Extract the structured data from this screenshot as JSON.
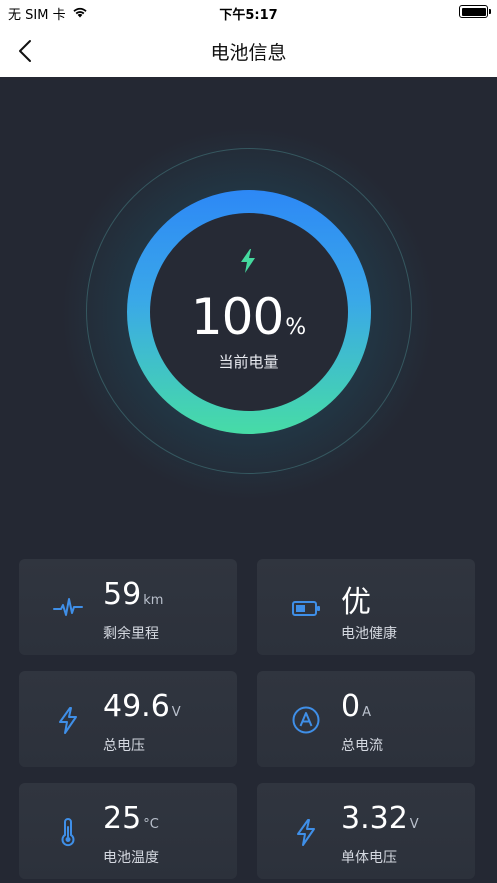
{
  "status_bar": {
    "carrier": "无 SIM 卡",
    "time": "下午5:17"
  },
  "nav": {
    "title": "电池信息"
  },
  "gauge": {
    "percent": "100",
    "unit": "%",
    "label": "当前电量",
    "level": 1.0
  },
  "cards": [
    {
      "value": "59",
      "unit": "km",
      "label": "剩余里程",
      "icon": "pulse-icon"
    },
    {
      "value": "优",
      "unit": "",
      "label": "电池健康",
      "icon": "battery-icon"
    },
    {
      "value": "49.6",
      "unit": "V",
      "label": "总电压",
      "icon": "bolt-icon"
    },
    {
      "value": "0",
      "unit": "A",
      "label": "总电流",
      "icon": "ampere-icon"
    },
    {
      "value": "25",
      "unit": "°C",
      "label": "电池温度",
      "icon": "thermometer-icon"
    },
    {
      "value": "3.32",
      "unit": "V",
      "label": "单体电压",
      "icon": "bolt-icon"
    }
  ],
  "colors": {
    "accent_blue": "#2d88f6",
    "accent_green": "#47dca6",
    "icon_blue": "#3f8fe8",
    "background": "#242833"
  }
}
